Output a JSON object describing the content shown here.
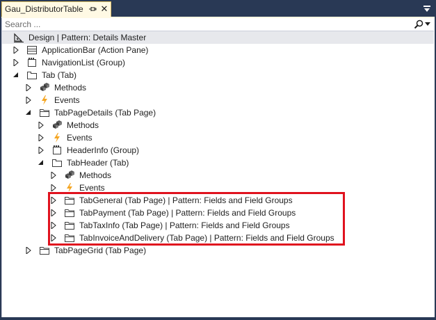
{
  "window": {
    "tab_title": "Gau_DistributorTable",
    "close_glyph": "✕"
  },
  "search": {
    "placeholder": "Search ..."
  },
  "tree": {
    "root": "Design | Pattern: Details Master",
    "application_bar": "ApplicationBar (Action Pane)",
    "navigation_list": "NavigationList (Group)",
    "tab": "Tab (Tab)",
    "tab_methods": "Methods",
    "tab_events": "Events",
    "tab_page_details": "TabPageDetails (Tab Page)",
    "details_methods": "Methods",
    "details_events": "Events",
    "header_info": "HeaderInfo (Group)",
    "tab_header": "TabHeader (Tab)",
    "header_methods": "Methods",
    "header_events": "Events",
    "tab_general": "TabGeneral (Tab Page) | Pattern: Fields and Field Groups",
    "tab_payment": "TabPayment (Tab Page) | Pattern: Fields and Field Groups",
    "tab_taxinfo": "TabTaxInfo (Tab Page) | Pattern: Fields and Field Groups",
    "tab_invoice": "TabInvoiceAndDelivery (Tab Page) | Pattern: Fields and Field Groups",
    "tab_page_grid": "TabPageGrid (Tab Page)"
  },
  "colors": {
    "chrome": "#293955",
    "active_tab": "#fff9e4",
    "root_row": "#e7e8ec",
    "highlight_box": "#e0121e",
    "events_icon": "#f5a623"
  },
  "icons": {
    "pin": "pin-icon",
    "close": "close-icon",
    "search": "search-icon",
    "design": "design-icon",
    "action_pane": "action-pane-icon",
    "group": "group-icon",
    "tab": "tab-icon",
    "methods": "methods-icon",
    "events": "lightning-icon",
    "tab_page": "folder-icon"
  }
}
